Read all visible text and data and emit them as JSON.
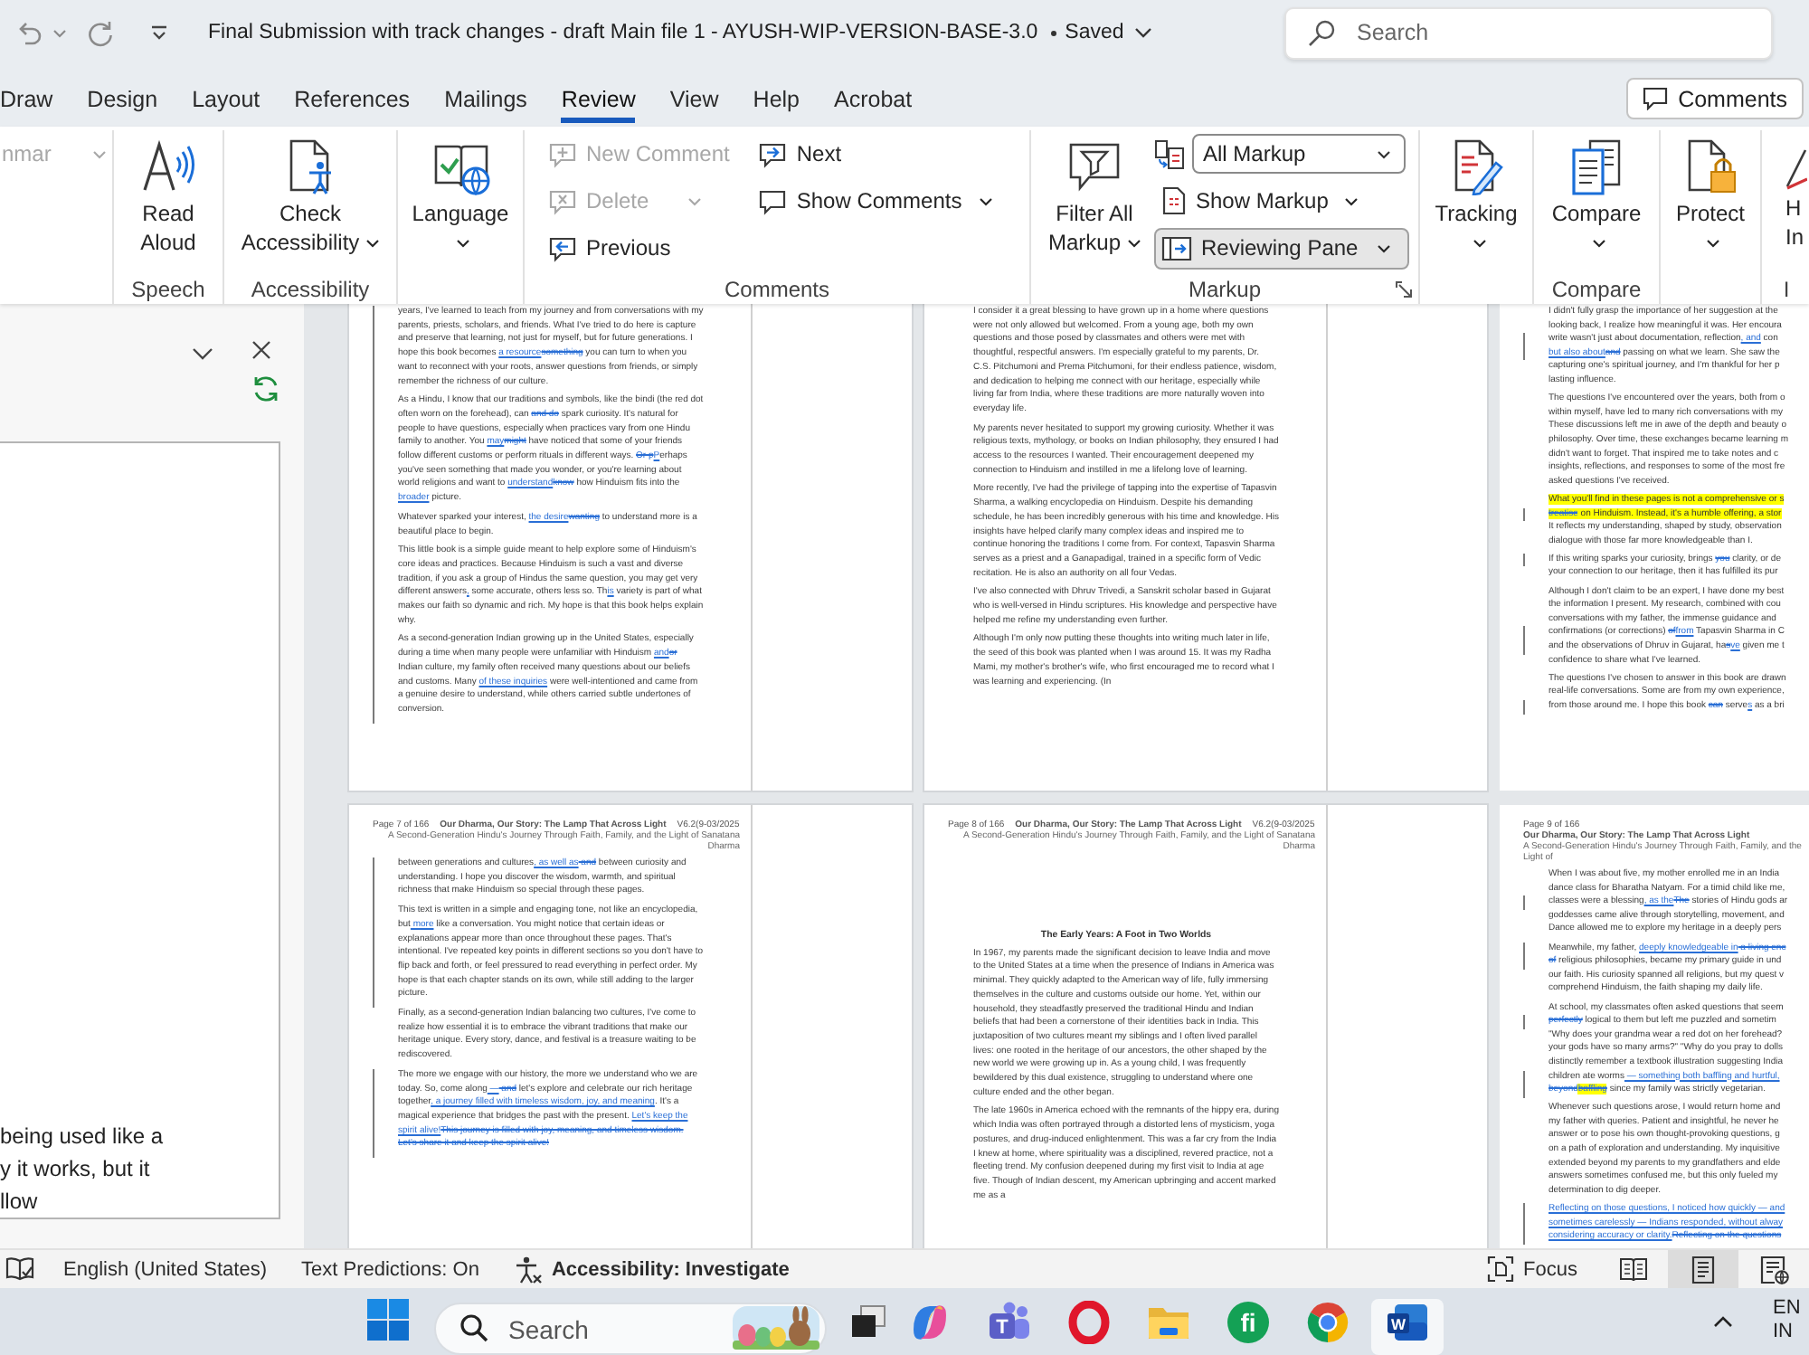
{
  "title_bar": {
    "title": "Final Submission with track changes - draft Main file 1 - AYUSH-WIP-VERSION-BASE-3.0",
    "save_status": "Saved",
    "search": {
      "placeholder": "Search"
    }
  },
  "tabs": [
    {
      "label": "Draw",
      "selected": false
    },
    {
      "label": "Design",
      "selected": false
    },
    {
      "label": "Layout",
      "selected": false
    },
    {
      "label": "References",
      "selected": false
    },
    {
      "label": "Mailings",
      "selected": false
    },
    {
      "label": "Review",
      "selected": true
    },
    {
      "label": "View",
      "selected": false
    },
    {
      "label": "Help",
      "selected": false
    },
    {
      "label": "Acrobat",
      "selected": false
    }
  ],
  "comments_button": {
    "label": "Comments"
  },
  "ribbon": {
    "groups": [
      {
        "items": [
          {
            "kind": "small",
            "label": "nmar",
            "disabled": true,
            "menu": true
          }
        ]
      },
      {
        "label": "Speech",
        "items": [
          {
            "kind": "large",
            "label": "Read Aloud",
            "disabled": false,
            "menu": false
          }
        ]
      },
      {
        "label": "Accessibility",
        "items": [
          {
            "kind": "large",
            "label": "Check Accessibility",
            "disabled": false,
            "menu": true
          }
        ]
      },
      {
        "items": [
          {
            "kind": "large",
            "label": "Language",
            "disabled": false,
            "menu": true
          }
        ]
      },
      {
        "label": "Comments",
        "items": [
          {
            "kind": "small",
            "label": "New Comment",
            "disabled": true,
            "menu": false
          },
          {
            "kind": "small",
            "label": "Delete",
            "disabled": true,
            "menu": true
          },
          {
            "kind": "small",
            "label": "Previous",
            "disabled": false,
            "menu": false
          },
          {
            "kind": "small",
            "label": "Next",
            "disabled": false,
            "menu": false
          },
          {
            "kind": "small",
            "label": "Show Comments",
            "disabled": false,
            "menu": true
          }
        ]
      },
      {
        "label": "Markup",
        "launcher": true,
        "items": [
          {
            "kind": "large",
            "label": "Filter All Markup",
            "disabled": false,
            "menu": true,
            "on": false
          },
          {
            "kind": "select",
            "value": "All Markup",
            "disabled": false,
            "menu": true,
            "on": false
          },
          {
            "kind": "small",
            "label": "Show Markup",
            "disabled": false,
            "menu": true,
            "on": false
          },
          {
            "kind": "small",
            "label": "Reviewing Pane",
            "disabled": false,
            "menu": true,
            "on": true
          }
        ]
      },
      {
        "items": [
          {
            "kind": "large",
            "label": "Tracking",
            "disabled": false,
            "menu": true
          }
        ]
      },
      {
        "label": "Compare",
        "items": [
          {
            "kind": "large",
            "label": "Compare",
            "disabled": false,
            "menu": true
          }
        ]
      },
      {
        "items": [
          {
            "kind": "large",
            "label": "Protect",
            "disabled": false,
            "menu": true
          }
        ]
      },
      {
        "label": "I",
        "items": [
          {
            "kind": "cut",
            "label": "H In",
            "disabled": false,
            "menu": false
          }
        ]
      }
    ]
  },
  "reviewing_pane": {
    "lines": [
      "being used like a",
      "y it works, but it",
      "llow"
    ]
  },
  "document": {
    "pages": [
      {
        "kind": "flow",
        "paragraphs": [
          {
            "segments": [
              {
                "text": "years, I've learned to teach from my journey and from conversations with my parents, priests, scholars, and friends. What I've tried to do here is capture and preserve that learning, not just for myself, but for future generations. I hope this book becomes ",
                "kind": "plain"
              },
              {
                "text": "a resource",
                "kind": "insert"
              },
              {
                "text": "something",
                "kind": "delete"
              },
              {
                "text": " you can turn to when you want to reconnect with your roots, answer questions from friends, or simply remember the richness of our culture.",
                "kind": "plain"
              }
            ]
          },
          {
            "segments": [
              {
                "text": "As a Hindu, I know that our traditions and symbols, like the bindi (the red dot often worn on the forehead), can ",
                "kind": "plain"
              },
              {
                "text": "and do",
                "kind": "delete"
              },
              {
                "text": " spark curiosity. It's natural for people to have questions, especially when practices vary from one Hindu family to another. You ",
                "kind": "plain"
              },
              {
                "text": "may",
                "kind": "insert"
              },
              {
                "text": "might",
                "kind": "delete"
              },
              {
                "text": " have noticed that some of your friends follow different customs or perform rituals in different ways. ",
                "kind": "plain"
              },
              {
                "text": "Or p",
                "kind": "delete"
              },
              {
                "text": "P",
                "kind": "insert"
              },
              {
                "text": "erhaps you've seen something that made you wonder, or you're learning about world religions and want to ",
                "kind": "plain"
              },
              {
                "text": "understand",
                "kind": "insert"
              },
              {
                "text": "know",
                "kind": "delete"
              },
              {
                "text": " how Hinduism fits into the",
                "kind": "plain"
              },
              {
                "text": " broader",
                "kind": "insert"
              },
              {
                "text": " picture.",
                "kind": "plain"
              }
            ]
          },
          {
            "segments": [
              {
                "text": "Whatever sparked your interest, ",
                "kind": "plain"
              },
              {
                "text": "the desire",
                "kind": "insert"
              },
              {
                "text": "wanting",
                "kind": "delete"
              },
              {
                "text": " to understand more is a beautiful place to begin.",
                "kind": "plain"
              }
            ]
          },
          {
            "segments": [
              {
                "text": "This little book is a simple guide meant to help explore some of Hinduism's core ideas and practices. Because Hinduism is such a vast and diverse tradition, if you ask a group of Hindus the same question, you may get very different answers",
                "kind": "plain"
              },
              {
                "text": ",",
                "kind": "insert"
              },
              {
                "text": " some accurate, others less so. Th",
                "kind": "plain"
              },
              {
                "text": "is",
                "kind": "insert"
              },
              {
                "text": " variety is part of what makes our faith so dynamic and rich. My hope is that this book helps explain why.",
                "kind": "plain"
              }
            ]
          },
          {
            "segments": [
              {
                "text": "As a second-generation Indian growing up in the United States, especially during a time when many people were unfamiliar with Hinduism ",
                "kind": "plain"
              },
              {
                "text": "and",
                "kind": "insert"
              },
              {
                "text": "or",
                "kind": "delete"
              },
              {
                "text": " Indian culture, my family often received many questions about our beliefs and customs. Many ",
                "kind": "plain"
              },
              {
                "text": "of these inquiries",
                "kind": "insert"
              },
              {
                "text": " were well-intentioned and came from a genuine desire to understand, while others carried subtle undertones of conversion.",
                "kind": "plain"
              }
            ]
          }
        ]
      },
      {
        "kind": "flow",
        "paragraphs": [
          {
            "segments": [
              {
                "text": "I consider it a great blessing to have grown up in a home where questions were not only allowed but welcomed. From a young age, both my own questions and those posed by classmates and others were met with thoughtful, respectful answers. I'm especially grateful to my parents, Dr. C.S. Pitchumoni and Prema Pitchumoni, for their endless patience, wisdom, and dedication to helping me connect with our heritage, especially while living far from India, where these traditions are more naturally woven into everyday life.",
                "kind": "plain"
              }
            ]
          },
          {
            "segments": [
              {
                "text": "My parents never hesitated to support my growing curiosity. Whether it was religious texts, mythology, or books on Indian philosophy, they ensured I had access to the resources I wanted. Their encouragement deepened my connection to Hinduism and instilled in me a lifelong love of learning.",
                "kind": "plain"
              }
            ]
          },
          {
            "segments": [
              {
                "text": "More recently, I've had the privilege of tapping into the expertise of Tapasvin Sharma, a walking encyclopedia on Hinduism. Despite his demanding schedule, he has been incredibly generous with his time and knowledge. His insights have helped clarify many complex ideas and inspired me to continue honoring the traditions I come from. For context, Tapasvin Sharma serves as a priest and a Ganapadigal, trained in a specific form of Vedic recitation. He is also an authority on all four Vedas.",
                "kind": "plain"
              }
            ]
          },
          {
            "segments": [
              {
                "text": "I've also connected with Dhruv Trivedi, a Sanskrit scholar based in Gujarat who is well-versed in Hindu scriptures. His knowledge and perspective have helped me refine my understanding even further.",
                "kind": "plain"
              }
            ]
          },
          {
            "segments": [
              {
                "text": "Although I'm only now putting these thoughts into writing much later in life, the seed of this book was planted when I was around 15. It was my Radha Mami, my mother's brother's wife, who first encouraged me to record what I was learning and experiencing. (In",
                "kind": "plain"
              }
            ]
          }
        ]
      },
      {
        "kind": "cut",
        "paragraphs": [
          {
            "lines": [
              [
                {
                  "text": "I didn't fully grasp the importance of her suggestion at the",
                  "kind": "plain"
                }
              ],
              [
                {
                  "text": "looking back, I realize how meaningful it was. Her encoura",
                  "kind": "plain"
                }
              ],
              [
                {
                  "text": "write wasn't just about documentation, reflection",
                  "kind": "plain"
                },
                {
                  "text": ", and",
                  "kind": "insert"
                },
                {
                  "text": " con",
                  "kind": "plain"
                }
              ],
              [
                {
                  "text": "but also about",
                  "kind": "insert"
                },
                {
                  "text": "and",
                  "kind": "delete"
                },
                {
                  "text": " passing on what we learn. She saw the",
                  "kind": "plain"
                }
              ],
              [
                {
                  "text": "capturing one's spiritual journey, and I'm thankful for her p",
                  "kind": "plain"
                }
              ],
              [
                {
                  "text": "lasting influence.",
                  "kind": "plain"
                }
              ]
            ]
          },
          {
            "lines": [
              [
                {
                  "text": "The questions I've encountered over the years, both from o",
                  "kind": "plain"
                }
              ],
              [
                {
                  "text": "within myself, have led to many rich conversations with my",
                  "kind": "plain"
                }
              ],
              [
                {
                  "text": "These discussions left me in awe of the depth and beauty o",
                  "kind": "plain"
                }
              ],
              [
                {
                  "text": "philosophy. Over time, these exchanges became learning m",
                  "kind": "plain"
                }
              ],
              [
                {
                  "text": "didn't want to forget. That inspired me to take notes and c",
                  "kind": "plain"
                }
              ],
              [
                {
                  "text": "insights, reflections, and responses to some of the most fre",
                  "kind": "plain"
                }
              ],
              [
                {
                  "text": "asked questions I've received.",
                  "kind": "plain"
                }
              ]
            ]
          },
          {
            "lines": [
              [
                {
                  "text": "What you'll find in these pages is not a comprehensive or s",
                  "kind": "highlight"
                }
              ],
              [
                {
                  "text": "treatise",
                  "kind": "highlight-delete"
                },
                {
                  "text": " on Hinduism. Instead, it's a humble offering, a stor",
                  "kind": "highlight"
                }
              ],
              [
                {
                  "text": "It reflects my understanding, shaped by study, observation",
                  "kind": "plain"
                }
              ],
              [
                {
                  "text": "dialogue with those far more knowledgeable than I.",
                  "kind": "plain"
                }
              ]
            ]
          },
          {
            "lines": [
              [
                {
                  "text": "If this writing sparks your curiosity, brings ",
                  "kind": "plain"
                },
                {
                  "text": "you",
                  "kind": "delete"
                },
                {
                  "text": " clarity, or de",
                  "kind": "plain"
                }
              ],
              [
                {
                  "text": "your connection to our heritage, then it has fulfilled its pur",
                  "kind": "plain"
                }
              ]
            ]
          },
          {
            "lines": [
              [
                {
                  "text": "Although I don't claim to be an expert, I have done my best",
                  "kind": "plain"
                }
              ],
              [
                {
                  "text": "the information I present. My research, combined with cou",
                  "kind": "plain"
                }
              ],
              [
                {
                  "text": "conversations with my father, the immense guidance and",
                  "kind": "plain"
                }
              ],
              [
                {
                  "text": "confirmations (or corrections) ",
                  "kind": "plain"
                },
                {
                  "text": "of",
                  "kind": "delete"
                },
                {
                  "text": "from",
                  "kind": "insert"
                },
                {
                  "text": " Tapasvin Sharma in C",
                  "kind": "plain"
                }
              ],
              [
                {
                  "text": "and the observations of Dhruv in Gujarat, ha",
                  "kind": "plain"
                },
                {
                  "text": "s",
                  "kind": "delete"
                },
                {
                  "text": "ve",
                  "kind": "insert"
                },
                {
                  "text": " given me t",
                  "kind": "plain"
                }
              ],
              [
                {
                  "text": "confidence to share what I've learned.",
                  "kind": "plain"
                }
              ]
            ]
          },
          {
            "lines": [
              [
                {
                  "text": "The questions I've chosen to answer in this book are drawn",
                  "kind": "plain"
                }
              ],
              [
                {
                  "text": "real-life conversations. Some are from my own experience,",
                  "kind": "plain"
                }
              ],
              [
                {
                  "text": "from those around me. I hope this book ",
                  "kind": "plain"
                },
                {
                  "text": "can",
                  "kind": "delete"
                },
                {
                  "text": " serve",
                  "kind": "plain"
                },
                {
                  "text": "s",
                  "kind": "insert"
                },
                {
                  "text": " as a bri",
                  "kind": "plain"
                }
              ]
            ]
          }
        ]
      },
      {
        "kind": "flow",
        "header": {
          "page_number": "Page 7 of 166",
          "title": "Our Dharma, Our Story: The Lamp That Across Light",
          "version": "V6.2(9-03/2025",
          "subtitle": "A Second-Generation Hindu's Journey Through Faith, Family, and the Light of Sanatana Dharma"
        },
        "paragraphs": [
          {
            "segments": [
              {
                "text": "between generations and cultures",
                "kind": "plain"
              },
              {
                "text": ", as well as",
                "kind": "insert"
              },
              {
                "text": " and",
                "kind": "delete"
              },
              {
                "text": " between curiosity and understanding. I hope you discover the wisdom, warmth, and spiritual richness that make Hinduism so special through these pages.",
                "kind": "plain"
              }
            ]
          },
          {
            "segments": [
              {
                "text": "This text is written in a simple and engaging tone, not like an encyclopedia, but",
                "kind": "plain"
              },
              {
                "text": " more",
                "kind": "insert"
              },
              {
                "text": " like a conversation. You might notice that certain ideas or explanations appear more than once throughout these pages. That's intentional. I've repeated key points in different sections so you don't have to flip back and forth, or feel pressured to read everything in perfect order. My hope is that each chapter stands on its own, while still adding to the larger picture.",
                "kind": "plain"
              }
            ]
          },
          {
            "segments": [
              {
                "text": "Finally, as a second-generation Indian balancing two cultures, I've come to realize how essential it is to embrace the vibrant traditions that make our heritage unique. Every story, dance, and festival is a treasure waiting to be rediscovered.",
                "kind": "plain"
              }
            ]
          },
          {
            "segments": [
              {
                "text": "The more we engage with our history, the more we understand who we are today. So, come along",
                "kind": "plain"
              },
              {
                "text": " —",
                "kind": "insert"
              },
              {
                "text": " and",
                "kind": "delete"
              },
              {
                "text": " let's explore and celebrate our rich heritage together",
                "kind": "plain"
              },
              {
                "text": ", a journey filled with timeless wisdom, joy, and meaning",
                "kind": "insert"
              },
              {
                "text": ". It's a magical experience that bridges the past with the present. ",
                "kind": "plain"
              },
              {
                "text": "Let's keep the spirit alive!",
                "kind": "insert"
              },
              {
                "text": "This journey is filled with joy, meaning, and timeless wisdom. Let's share it and keep the spirit alive!",
                "kind": "delete"
              }
            ]
          }
        ]
      },
      {
        "kind": "flow",
        "header": {
          "page_number": "Page 8 of 166",
          "title": "Our Dharma, Our Story: The Lamp That Across Light",
          "version": "V6.2(9-03/2025",
          "subtitle": "A Second-Generation Hindu's Journey Through Faith, Family, and the Light of Sanatana Dharma"
        },
        "heading": "The Early Years: A Foot in Two Worlds",
        "paragraphs": [
          {
            "segments": [
              {
                "text": "In 1967, my parents made the significant decision to leave India and move to the United States at a time when the presence of Indians in America was minimal. They quickly adapted to the American way of life, fully immersing themselves in the culture and customs outside our home. Yet, within our household, they steadfastly preserved the traditional Hindu and Indian beliefs that had been a cornerstone of their identities back in India. This juxtaposition of two cultures meant my siblings and I often lived parallel lives: one rooted in the heritage of our ancestors, the other shaped by the new world we were growing up in. As a young child, I was frequently bewildered by this dual existence, struggling to understand where one culture ended and the other began.",
                "kind": "plain"
              }
            ]
          },
          {
            "segments": [
              {
                "text": "The late 1960s in America echoed with the remnants of the hippy era, during which India was often portrayed through a distorted lens of mysticism, yoga postures, and drug-induced enlightenment. This was a far cry from the India I knew at home, where spirituality was a disciplined, revered practice, not a fleeting trend. My confusion deepened during my first visit to India at age five. Though of Indian descent, my American upbringing and accent marked me as a",
                "kind": "plain"
              }
            ]
          }
        ]
      },
      {
        "kind": "cut",
        "header": {
          "page_number": "Page 9 of 166",
          "title": "Our Dharma, Our Story: The Lamp That Across Light",
          "subtitle": "A Second-Generation Hindu's Journey Through Faith, Family, and the Light of"
        },
        "paragraphs": [
          {
            "lines": [
              [
                {
                  "text": "When I was about five, my mother enrolled me in an India",
                  "kind": "plain"
                }
              ],
              [
                {
                  "text": "dance class for Bharatha Natyam. For a timid child like me,",
                  "kind": "plain"
                }
              ],
              [
                {
                  "text": "classes were a blessing",
                  "kind": "plain"
                },
                {
                  "text": ", as the",
                  "kind": "insert"
                },
                {
                  "text": "The",
                  "kind": "delete"
                },
                {
                  "text": " stories of Hindu gods ar",
                  "kind": "plain"
                }
              ],
              [
                {
                  "text": "goddesses came alive through storytelling, movement, and",
                  "kind": "plain"
                }
              ],
              [
                {
                  "text": "Dance allowed me to explore my heritage in a deeply pers",
                  "kind": "plain"
                }
              ]
            ]
          },
          {
            "lines": [
              [
                {
                  "text": "Meanwhile, my father, ",
                  "kind": "plain"
                },
                {
                  "text": "deeply knowledgeable in",
                  "kind": "insert"
                },
                {
                  "text": " a living enc",
                  "kind": "delete"
                }
              ],
              [
                {
                  "text": "of",
                  "kind": "delete"
                },
                {
                  "text": " religious philosophies, became my primary guide in und",
                  "kind": "plain"
                }
              ],
              [
                {
                  "text": "our faith. His curiosity spanned all religions, but my quest v",
                  "kind": "plain"
                }
              ],
              [
                {
                  "text": "comprehend Hinduism, the faith shaping my daily life.",
                  "kind": "plain"
                }
              ]
            ]
          },
          {
            "lines": [
              [
                {
                  "text": "At school, my classmates often asked questions that seem",
                  "kind": "plain"
                }
              ],
              [
                {
                  "text": "perfectly",
                  "kind": "delete"
                },
                {
                  "text": " logical to them but left me puzzled and sometim",
                  "kind": "plain"
                }
              ],
              [
                {
                  "text": "\"Why does your grandma wear a red dot on her forehead?",
                  "kind": "plain"
                }
              ],
              [
                {
                  "text": "your gods have so many arms?\" \"Why do you pray to dolls",
                  "kind": "plain"
                }
              ],
              [
                {
                  "text": "distinctly remember a textbook illustration suggesting India",
                  "kind": "plain"
                }
              ],
              [
                {
                  "text": "children ate worms",
                  "kind": "plain"
                },
                {
                  "text": " — something both baffling and hurtful,",
                  "kind": "insert"
                }
              ],
              [
                {
                  "text": "beyond",
                  "kind": "delete"
                },
                {
                  "text": "baffling",
                  "kind": "highlight-delete"
                },
                {
                  "text": " since my family was strictly vegetarian.",
                  "kind": "plain"
                }
              ]
            ]
          },
          {
            "lines": [
              [
                {
                  "text": "Whenever such questions arose, I would return home and",
                  "kind": "plain"
                }
              ],
              [
                {
                  "text": "my father with queries. Patient and insightful, he never he",
                  "kind": "plain"
                }
              ],
              [
                {
                  "text": "answer or to pose his own thought-provoking questions, g",
                  "kind": "plain"
                }
              ],
              [
                {
                  "text": "on a path of exploration and understanding. My inquisitive",
                  "kind": "plain"
                }
              ],
              [
                {
                  "text": "extended beyond my parents to my grandfathers and elde",
                  "kind": "plain"
                }
              ],
              [
                {
                  "text": "answers sometimes confused me, but this only fueled my",
                  "kind": "plain"
                }
              ],
              [
                {
                  "text": "determination to dig deeper.",
                  "kind": "plain"
                }
              ]
            ]
          },
          {
            "lines": [
              [
                {
                  "text": "Reflecting on those questions, I noticed how quickly — and",
                  "kind": "insert"
                }
              ],
              [
                {
                  "text": "sometimes carelessly — Indians responded, without alway",
                  "kind": "insert"
                }
              ],
              [
                {
                  "text": "considering accuracy or clarity.",
                  "kind": "insert"
                },
                {
                  "text": "Reflecting on the questions",
                  "kind": "delete"
                }
              ]
            ]
          }
        ]
      }
    ]
  },
  "status_bar": {
    "language": "English (United States)",
    "text_predictions": "Text Predictions: On",
    "accessibility": "Accessibility: Investigate",
    "focus": "Focus",
    "views": [
      {
        "kind": "read",
        "selected": false
      },
      {
        "kind": "print",
        "selected": true
      },
      {
        "kind": "web",
        "selected": false
      }
    ]
  },
  "taskbar": {
    "search": {
      "placeholder": "Search"
    },
    "apps": [
      {
        "kind": "copilot",
        "selected": false
      },
      {
        "kind": "teams",
        "text": "T",
        "selected": false
      },
      {
        "kind": "opera",
        "selected": false
      },
      {
        "kind": "explorer",
        "selected": false
      },
      {
        "kind": "fi",
        "text": "fi",
        "selected": false
      },
      {
        "kind": "chrome",
        "selected": false
      },
      {
        "kind": "word",
        "text": "W",
        "selected": true
      }
    ],
    "language": [
      "EN",
      "IN"
    ]
  }
}
